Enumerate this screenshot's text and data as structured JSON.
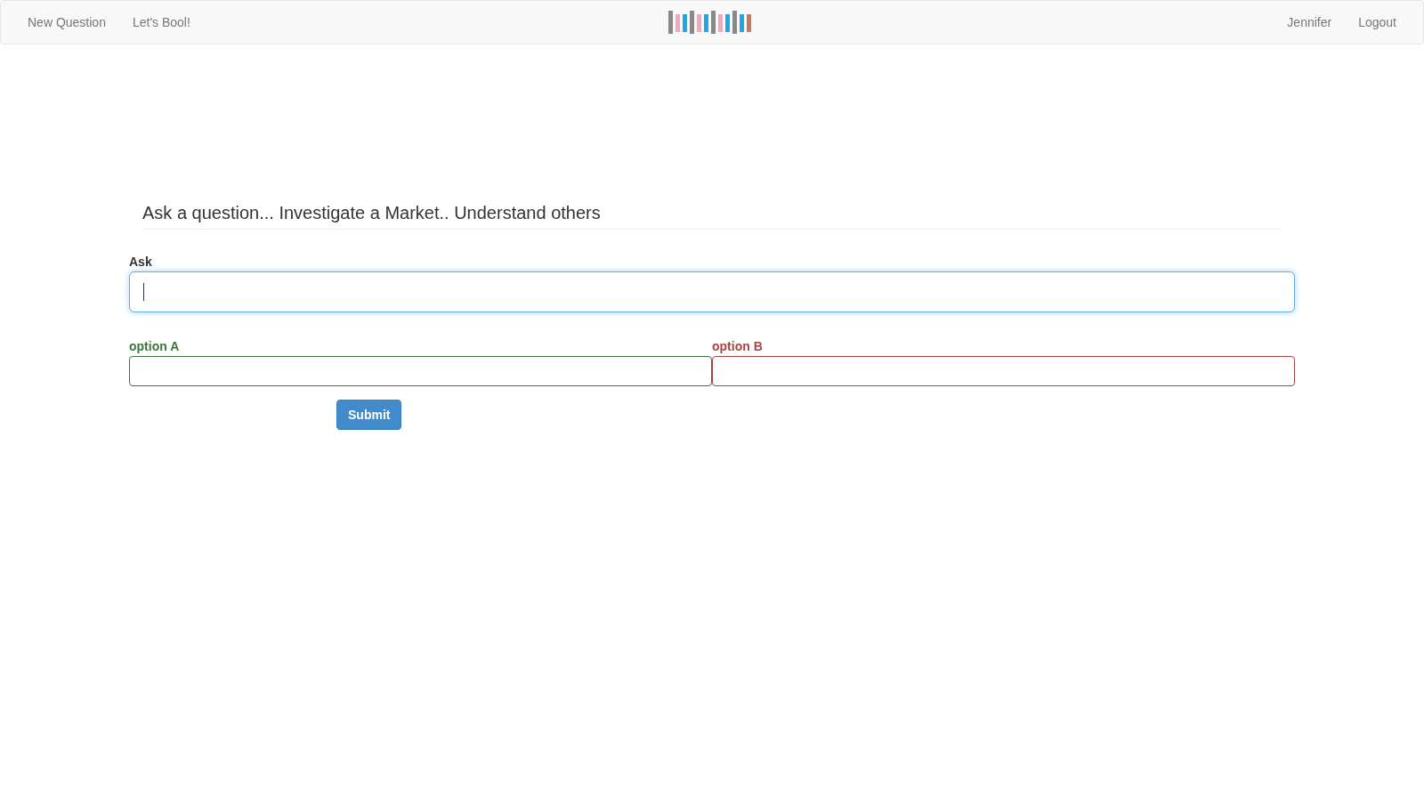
{
  "navbar": {
    "left_links": [
      "New Question",
      "Let's Bool!"
    ],
    "right_links": [
      "Jennifer",
      "Logout"
    ]
  },
  "heading": "Ask a question... Investigate a Market.. Understand others",
  "ask": {
    "label": "Ask",
    "focused": true
  },
  "options": [
    {
      "label": "option A",
      "color": "#3c763d"
    },
    {
      "label": "option B",
      "color": "#a94442"
    }
  ],
  "submit": "Submit"
}
